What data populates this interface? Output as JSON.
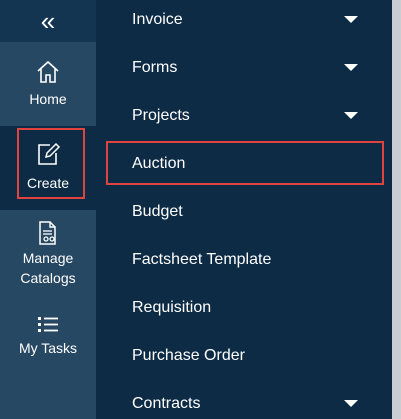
{
  "rail": {
    "collapse_glyph": "«",
    "items": [
      {
        "label": "Home",
        "icon": "home-icon"
      },
      {
        "label": "Create",
        "icon": "edit-icon"
      },
      {
        "label": "Manage\nCatalogs",
        "icon": "catalog-icon"
      },
      {
        "label": "My Tasks",
        "icon": "list-icon"
      }
    ]
  },
  "menu": {
    "items": [
      {
        "label": "Invoice",
        "has_submenu": true
      },
      {
        "label": "Forms",
        "has_submenu": true
      },
      {
        "label": "Projects",
        "has_submenu": true
      },
      {
        "label": "Auction",
        "has_submenu": false
      },
      {
        "label": "Budget",
        "has_submenu": false
      },
      {
        "label": "Factsheet Template",
        "has_submenu": false
      },
      {
        "label": "Requisition",
        "has_submenu": false
      },
      {
        "label": "Purchase Order",
        "has_submenu": false
      },
      {
        "label": "Contracts",
        "has_submenu": true
      }
    ]
  },
  "colors": {
    "panel_bg": "#0d2b45",
    "rail_bg": "#274863",
    "highlight": "#e0443e"
  }
}
